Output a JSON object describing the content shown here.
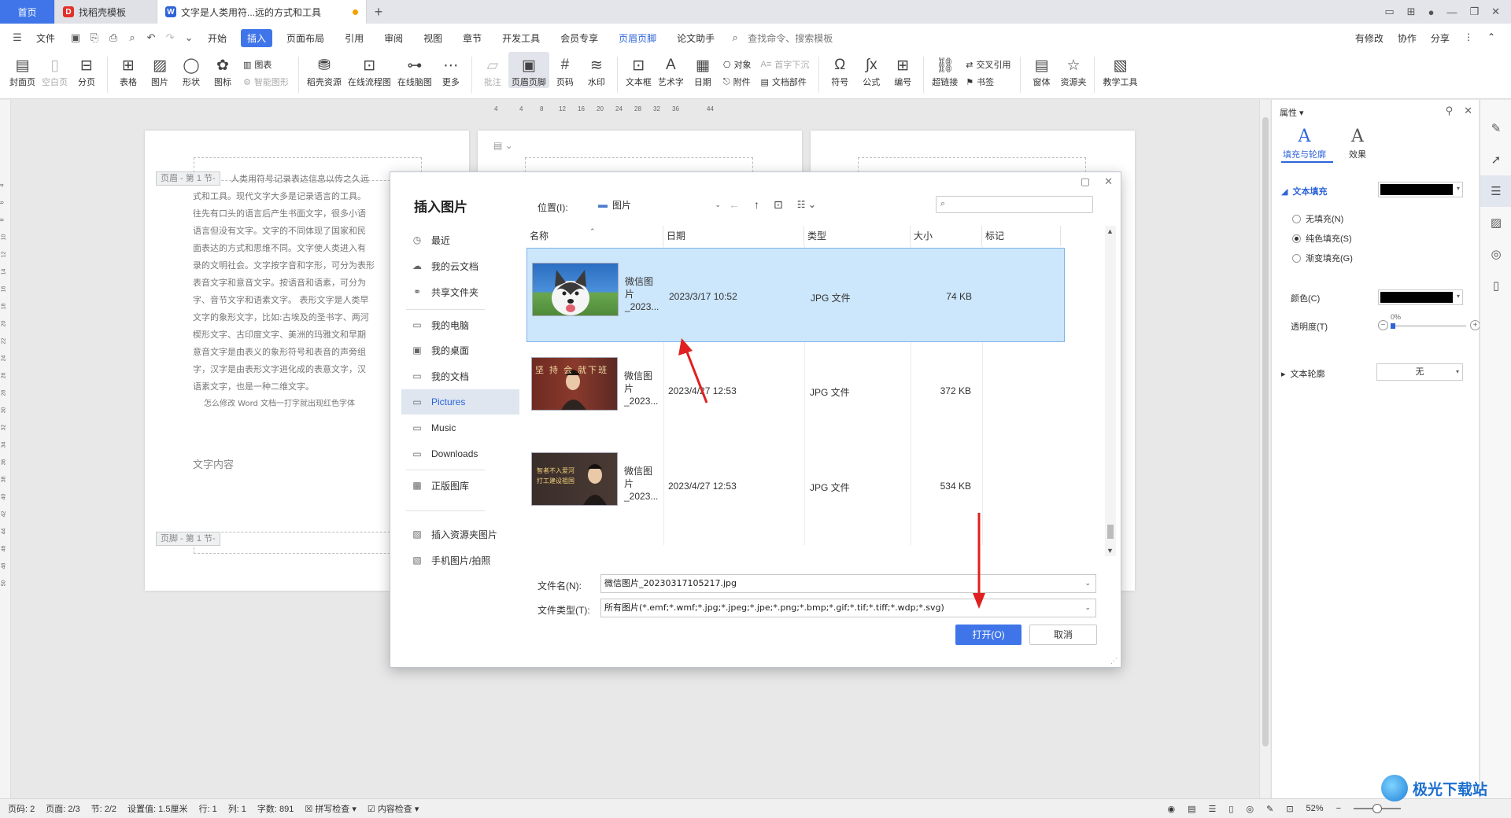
{
  "tabs": {
    "home": "首页",
    "template": "找稻壳模板",
    "document": "文字是人类用符...远的方式和工具"
  },
  "menu": {
    "file": "文件",
    "items": [
      "开始",
      "插入",
      "页面布局",
      "引用",
      "审阅",
      "视图",
      "章节",
      "开发工具",
      "会员专享",
      "页眉页脚",
      "论文助手"
    ],
    "active_index": 1,
    "search": "查找命令、搜索模板",
    "modified": "有修改",
    "collab": "协作",
    "share": "分享"
  },
  "ribbon": {
    "items": [
      "封面页",
      "空白页",
      "分页",
      "表格",
      "图片",
      "形状",
      "图标",
      "稻壳资源",
      "在线流程图",
      "在线脑图",
      "更多",
      "批注",
      "页眉页脚",
      "页码",
      "水印",
      "文本框",
      "艺术字",
      "日期",
      "符号",
      "公式",
      "编号",
      "超链接",
      "窗体",
      "资源夹",
      "教学工具"
    ],
    "stack_a": [
      "图表",
      "智能图形"
    ],
    "stack_b": [
      "对象",
      "附件"
    ],
    "stack_c": [
      "首字下沉",
      "文档部件"
    ],
    "stack_d": [
      "交叉引用",
      "书签"
    ]
  },
  "document": {
    "header_tag": "页眉 - 第 1 节-",
    "footer_tag": "页脚 - 第 1 节-",
    "lines": [
      "人类用符号记录表达信息以传之久远",
      "式和工具。现代文字大多是记录语言的工具。",
      "往先有口头的语言后产生书面文字，很多小语",
      "语言但没有文字。文字的不同体现了国家和民",
      "面表达的方式和思维不同。文字使人类进入有",
      "录的文明社会。文字按字音和字形，可分为表形",
      "表音文字和意音文字。按语音和语素，可分为",
      "字、音节文字和语素文字。 表形文字是人类早",
      "文字的象形文字，比如:古埃及的圣书字、两河",
      "楔形文字、古印度文字、美洲的玛雅文和早期",
      "意音文字是由表义的象形符号和表音的声旁组",
      "字，汉字是由表形文字进化成的表意文字，汉",
      "语素文字，也是一种二维文字。"
    ],
    "note_line": "怎么修改 Word 文档一打字就出现红色字体",
    "content_label": "文字内容",
    "ruler_h": [
      "4",
      "4",
      "8",
      "12",
      "16",
      "20",
      "24",
      "28",
      "32",
      "36",
      "44"
    ],
    "ruler_v": [
      "4",
      "6",
      "8",
      "10",
      "12",
      "14",
      "16",
      "18",
      "20",
      "22",
      "24",
      "26",
      "28",
      "30",
      "32",
      "34",
      "36",
      "38",
      "40",
      "42",
      "44",
      "46",
      "48",
      "50"
    ]
  },
  "panel": {
    "title": "属性",
    "tab_fill": "填充与轮廓",
    "tab_effect": "效果",
    "text_fill": "文本填充",
    "no_fill": "无填充(N)",
    "solid_fill": "纯色填充(S)",
    "gradient_fill": "渐变填充(G)",
    "color": "颜色(C)",
    "transparency": "透明度(T)",
    "transparency_value": "0%",
    "text_outline": "文本轮廓",
    "outline_value": "无",
    "fill_color": "#000000"
  },
  "dialog": {
    "title": "插入图片",
    "location_label": "位置(I):",
    "location_value": "图片",
    "search_placeholder": "",
    "sidebar": [
      "最近",
      "我的云文档",
      "共享文件夹",
      "我的电脑",
      "我的桌面",
      "我的文档",
      "Pictures",
      "Music",
      "Downloads",
      "正版图库",
      "插入资源夹图片",
      "手机图片/拍照"
    ],
    "sidebar_selected": 6,
    "columns": [
      "名称",
      "日期",
      "类型",
      "大小",
      "标记"
    ],
    "files": [
      {
        "name": "微信图片_2023...",
        "date": "2023/3/17 10:52",
        "type": "JPG 文件",
        "size": "74 KB"
      },
      {
        "name": "微信图片_2023...",
        "date": "2023/4/27 12:53",
        "type": "JPG 文件",
        "size": "372 KB"
      },
      {
        "name": "微信图片_2023...",
        "date": "2023/4/27 12:53",
        "type": "JPG 文件",
        "size": "534 KB"
      }
    ],
    "selected_file": 0,
    "thumb2_text": "坚 持 会 就下班",
    "thumb3_text": "智者不入爱河 打工建设祖国",
    "filename_label": "文件名(N):",
    "filename_value": "微信图片_20230317105217.jpg",
    "filetype_label": "文件类型(T):",
    "filetype_value": "所有图片(*.emf;*.wmf;*.jpg;*.jpeg;*.jpe;*.png;*.bmp;*.gif;*.tif;*.tiff;*.wdp;*.svg)",
    "open": "打开(O)",
    "cancel": "取消"
  },
  "status": {
    "page_num": "页码: 2",
    "page": "页面: 2/3",
    "section": "节: 2/2",
    "setting": "设置值: 1.5厘米",
    "row": "行: 1",
    "col": "列: 1",
    "words": "字数: 891",
    "spell": "拼写检查",
    "content_check": "内容检查",
    "zoom": "52%"
  },
  "watermark": "极光下载站"
}
